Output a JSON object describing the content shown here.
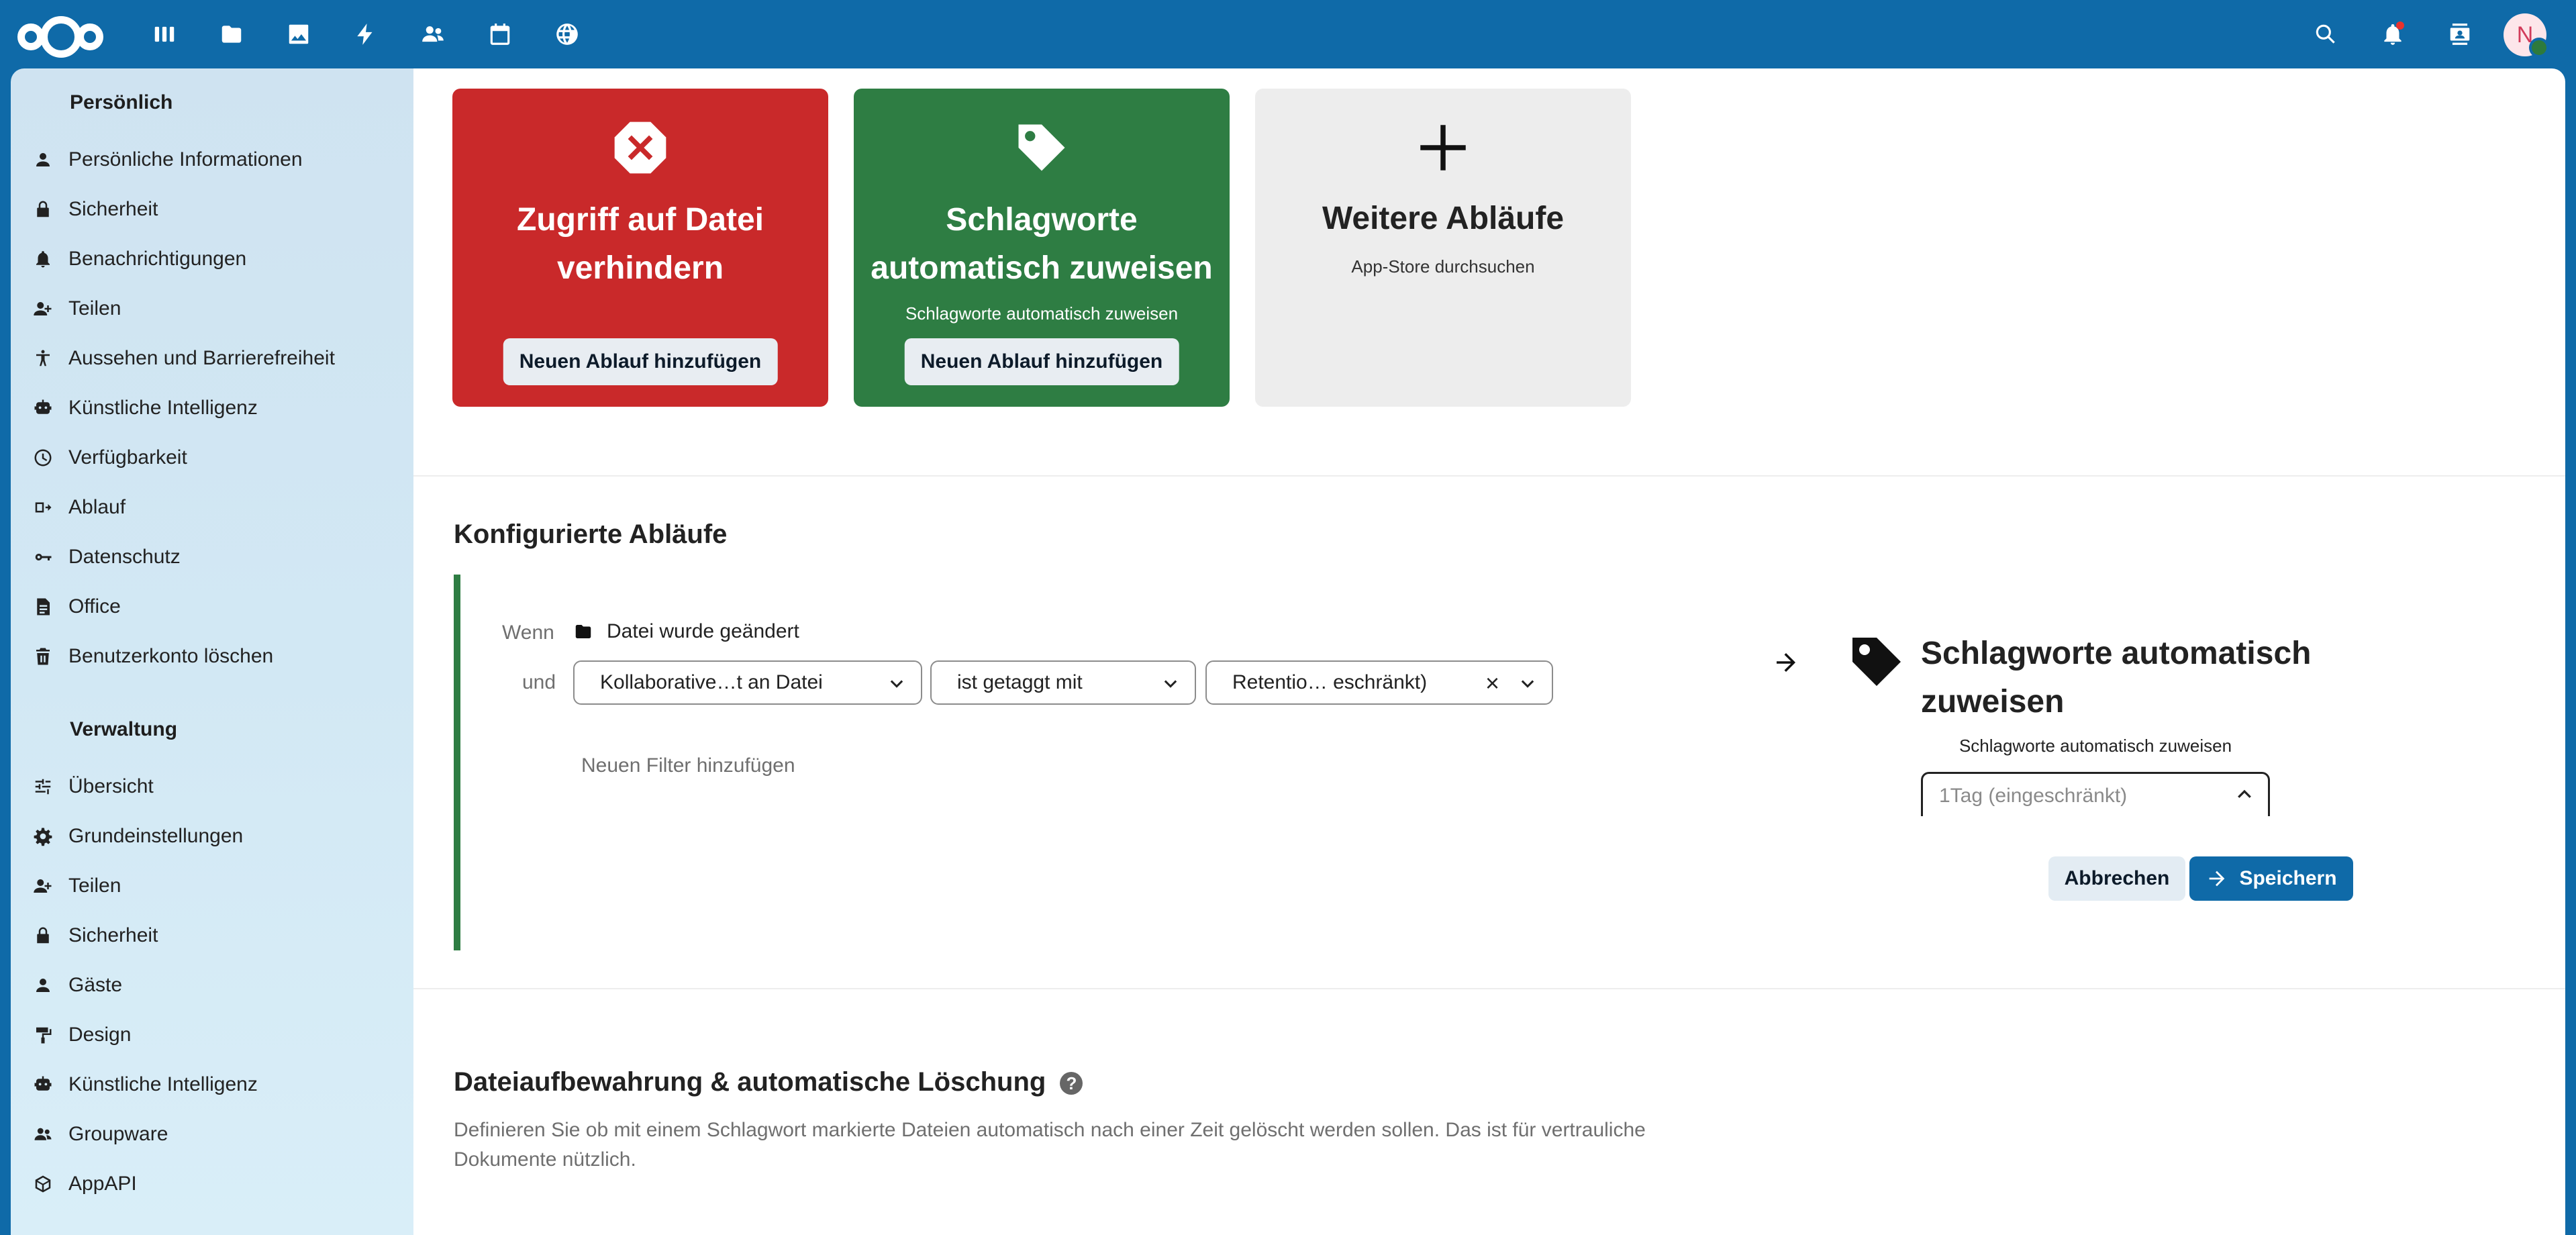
{
  "topbar": {
    "apps": [
      {
        "name": "dashboard-icon"
      },
      {
        "name": "files-icon"
      },
      {
        "name": "photos-icon"
      },
      {
        "name": "activity-icon"
      },
      {
        "name": "contacts-icon"
      },
      {
        "name": "calendar-icon"
      },
      {
        "name": "web-icon"
      }
    ],
    "avatar_initial": "N",
    "colors": {
      "bar": "#0f6aa8"
    }
  },
  "sidebar": {
    "personal_title": "Persönlich",
    "personal_items": [
      {
        "label": "Persönliche Informationen",
        "icon": "person-icon"
      },
      {
        "label": "Sicherheit",
        "icon": "lock-icon"
      },
      {
        "label": "Benachrichtigungen",
        "icon": "bell-icon"
      },
      {
        "label": "Teilen",
        "icon": "share-icon"
      },
      {
        "label": "Aussehen und Barrierefreiheit",
        "icon": "accessibility-icon"
      },
      {
        "label": "Künstliche Intelligenz",
        "icon": "robot-icon"
      },
      {
        "label": "Verfügbarkeit",
        "icon": "clock-icon"
      },
      {
        "label": "Ablauf",
        "icon": "flow-icon"
      },
      {
        "label": "Datenschutz",
        "icon": "key-icon"
      },
      {
        "label": "Office",
        "icon": "document-icon"
      },
      {
        "label": "Benutzerkonto löschen",
        "icon": "trash-icon"
      }
    ],
    "admin_title": "Verwaltung",
    "admin_items": [
      {
        "label": "Übersicht",
        "icon": "tune-icon"
      },
      {
        "label": "Grundeinstellungen",
        "icon": "gear-icon"
      },
      {
        "label": "Teilen",
        "icon": "share-icon"
      },
      {
        "label": "Sicherheit",
        "icon": "lock-icon"
      },
      {
        "label": "Gäste",
        "icon": "person-icon"
      },
      {
        "label": "Design",
        "icon": "paint-roller-icon"
      },
      {
        "label": "Künstliche Intelligenz",
        "icon": "robot-icon"
      },
      {
        "label": "Groupware",
        "icon": "group-icon"
      },
      {
        "label": "AppAPI",
        "icon": "cube-icon"
      }
    ]
  },
  "cards": [
    {
      "title": "Zugriff auf Datei verhindern",
      "desc": "",
      "button": "Neuen Ablauf hinzufügen",
      "color": "#c9292a"
    },
    {
      "title": "Schlagworte automatisch zuweisen",
      "desc": "Schlagworte automatisch zuweisen",
      "button": "Neuen Ablauf hinzufügen",
      "color": "#2e7d43"
    },
    {
      "title": "Weitere Abläufe",
      "desc": "App-Store durchsuchen",
      "button": "",
      "color": "#ededed"
    }
  ],
  "configured": {
    "title": "Konfigurierte Abläufe",
    "when_label": "Wenn",
    "event": "Datei wurde geändert",
    "and_label": "und",
    "filter_check": "Kollaborative…t an Datei",
    "filter_operator": "ist getaggt mit",
    "filter_value": "Retentio… eschränkt)",
    "add_filter": "Neuen Filter hinzufügen",
    "action_title": "Schlagworte automatisch zuweisen",
    "action_desc": "Schlagworte automatisch zuweisen",
    "tag_input_value": "1Tag (eingeschränkt)",
    "cancel_label": "Abbrechen",
    "save_label": "Speichern"
  },
  "retention": {
    "title": "Dateiaufbewahrung & automatische Löschung",
    "help": "?",
    "desc": "Definieren Sie ob mit einem Schlagwort markierte Dateien automatisch nach einer Zeit gelöscht werden sollen. Das ist für vertrauliche Dokumente nützlich."
  }
}
